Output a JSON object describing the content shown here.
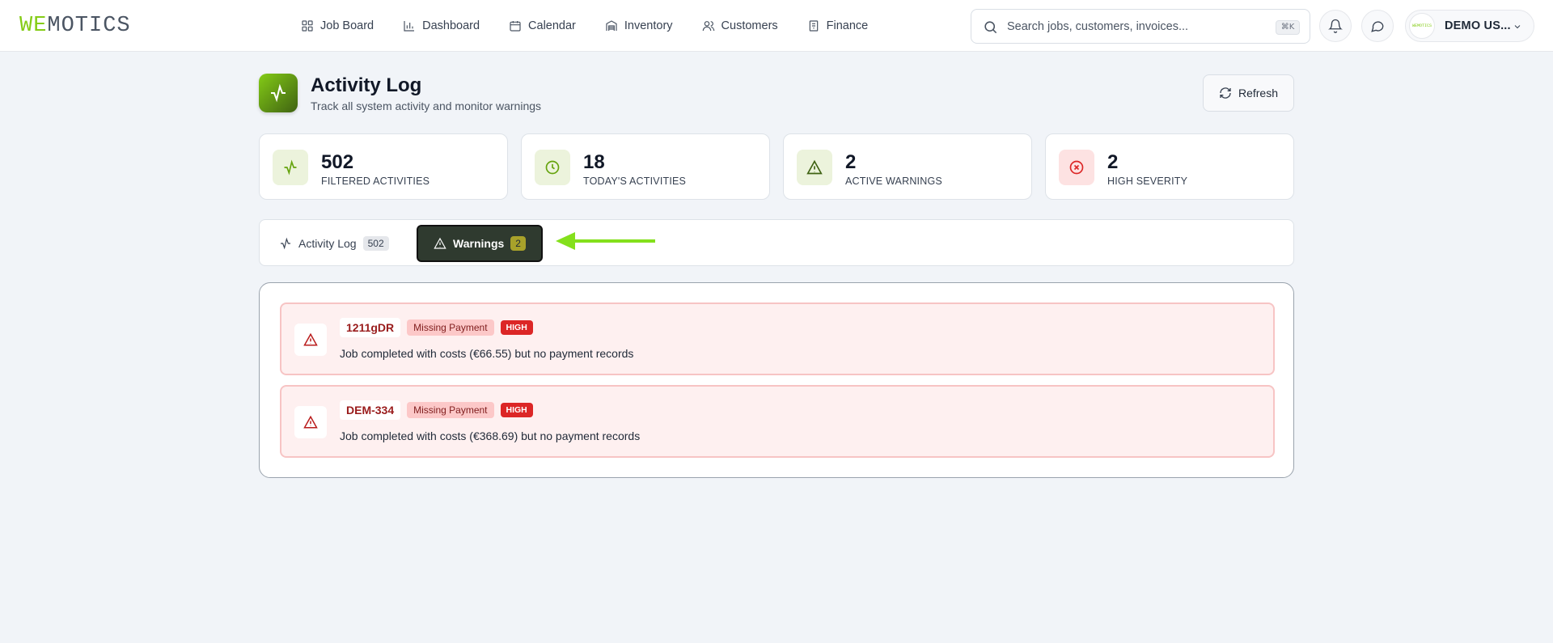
{
  "brand": {
    "logo_we": "WE",
    "logo_rest": "MOTICS"
  },
  "nav": [
    {
      "label": "Job Board",
      "icon": "grid-icon"
    },
    {
      "label": "Dashboard",
      "icon": "bar-chart-icon"
    },
    {
      "label": "Calendar",
      "icon": "calendar-icon"
    },
    {
      "label": "Inventory",
      "icon": "warehouse-icon"
    },
    {
      "label": "Customers",
      "icon": "users-icon"
    },
    {
      "label": "Finance",
      "icon": "receipt-icon"
    }
  ],
  "search": {
    "placeholder": "Search jobs, customers, invoices...",
    "shortcut": "⌘K"
  },
  "user": {
    "name": "DEMO US...",
    "avatar_text": "WEMOTICS"
  },
  "header": {
    "title": "Activity Log",
    "subtitle": "Track all system activity and monitor warnings",
    "refresh_label": "Refresh"
  },
  "stats": [
    {
      "value": "502",
      "label": "Filtered Activities",
      "icon": "activity-icon",
      "color": "#65a30d",
      "bg": "#ecf3dc"
    },
    {
      "value": "18",
      "label": "Today's Activities",
      "icon": "clock-icon",
      "color": "#65a30d",
      "bg": "#ecf3dc"
    },
    {
      "value": "2",
      "label": "Active Warnings",
      "icon": "alert-triangle-icon",
      "color": "#3f6212",
      "bg": "#ecf3dc"
    },
    {
      "value": "2",
      "label": "High Severity",
      "icon": "x-circle-icon",
      "color": "#dc2626",
      "bg": "#fde2e2"
    }
  ],
  "tabs": {
    "activity": {
      "label": "Activity Log",
      "count": "502"
    },
    "warnings": {
      "label": "Warnings",
      "count": "2",
      "active": true
    }
  },
  "warnings": [
    {
      "id": "1211gDR",
      "type": "Missing Payment",
      "severity": "HIGH",
      "message": "Job completed with costs (€66.55) but no payment records"
    },
    {
      "id": "DEM-334",
      "type": "Missing Payment",
      "severity": "HIGH",
      "message": "Job completed with costs (€368.69) but no payment records"
    }
  ],
  "colors": {
    "accent": "#84cc16",
    "arrow": "#84e01c",
    "active_tab": "#2f3a2f",
    "danger": "#dc2626"
  }
}
